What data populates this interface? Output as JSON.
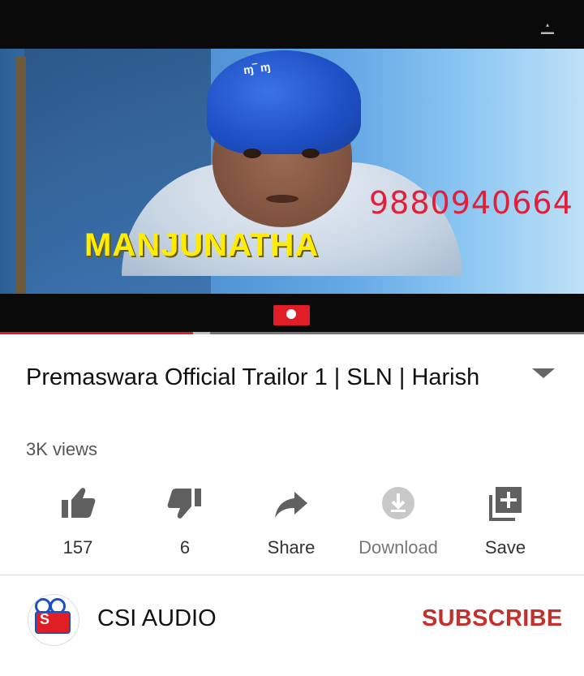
{
  "video": {
    "overlay_name": "MANJUNATHA",
    "overlay_phone": "9880940664",
    "progress_fraction": 0.33,
    "buffer_fraction": 0.36
  },
  "meta": {
    "title": "Premaswara Official Trailor 1 | SLN | Harish",
    "views": "3K views"
  },
  "actions": [
    {
      "icon": "thumbs-up-icon",
      "label": "157"
    },
    {
      "icon": "thumbs-down-icon",
      "label": "6"
    },
    {
      "icon": "share-icon",
      "label": "Share"
    },
    {
      "icon": "download-icon",
      "label": "Download"
    },
    {
      "icon": "save-playlist-icon",
      "label": "Save"
    }
  ],
  "channel": {
    "name": "CSI AUDIO",
    "subscribe_label": "SUBSCRIBE"
  },
  "colors": {
    "accent": "#e11e26",
    "subscribe": "#c4302b",
    "overlay_name": "#ffec00",
    "overlay_phone": "#e0203a"
  }
}
